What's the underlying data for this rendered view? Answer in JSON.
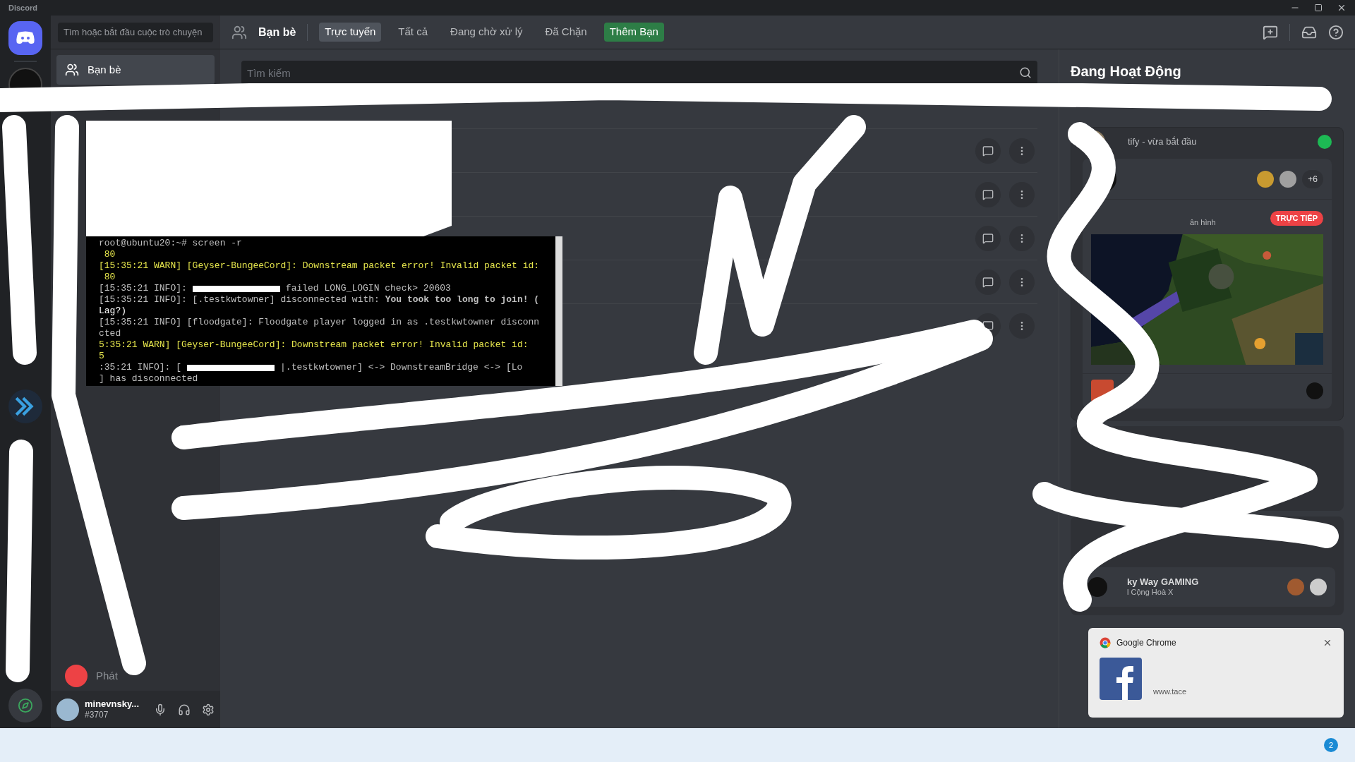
{
  "window": {
    "title": "Discord"
  },
  "sidebar": {
    "search": "Tìm hoặc bắt đầu cuộc trò chuyện",
    "items": [
      {
        "label": "Bạn bè",
        "selected": true
      },
      {
        "label": "Phát",
        "selected": false
      }
    ]
  },
  "user": {
    "name": "minevnsky...",
    "tag": "#3707"
  },
  "header": {
    "title": "Bạn bè",
    "tabs": [
      {
        "label": "Trực tuyến",
        "selected": true,
        "kind": "tab"
      },
      {
        "label": "Tất cả",
        "selected": false,
        "kind": "tab"
      },
      {
        "label": "Đang chờ xử lý",
        "selected": false,
        "kind": "tab"
      },
      {
        "label": "Đã Chặn",
        "selected": false,
        "kind": "tab"
      },
      {
        "label": "Thêm Bạn",
        "selected": false,
        "kind": "add"
      }
    ]
  },
  "search": {
    "placeholder": "Tìm kiếm"
  },
  "terminal": {
    "lines": [
      {
        "parts": [
          {
            "kind": "text",
            "color": "#c0c0c0",
            "text": "root@ubuntu20:~# screen -r"
          }
        ]
      },
      {
        "parts": [
          {
            "kind": "text",
            "color": "#e5e54c",
            "text": " 80"
          }
        ]
      },
      {
        "parts": [
          {
            "kind": "text",
            "color": "#e5e54c",
            "text": "[15:35:21 WARN] [Geyser-BungeeCord]: Downstream packet error! Invalid packet id:"
          }
        ]
      },
      {
        "parts": [
          {
            "kind": "text",
            "color": "#e5e54c",
            "text": " 80"
          }
        ]
      },
      {
        "parts": [
          {
            "kind": "text",
            "color": "#c0c0c0",
            "text": "[15:35:21 INFO]:"
          },
          {
            "kind": "redaction"
          },
          {
            "kind": "text",
            "color": "#c0c0c0",
            "text": "failed LONG_LOGIN check> 20603"
          }
        ]
      },
      {
        "parts": [
          {
            "kind": "text",
            "color": "#c0c0c0",
            "text": "[15:35:21 INFO]: [.testkwtowner] disconnected with: **You took too long to join! (**"
          }
        ]
      },
      {
        "parts": [
          {
            "kind": "text",
            "color": "#ffffff",
            "text": "Lag?)"
          }
        ]
      },
      {
        "parts": [
          {
            "kind": "text",
            "color": "#c0c0c0",
            "text": "[15:35:21 INFO] [floodgate]: Floodgate player logged in as .testkwtowner disconn"
          }
        ]
      },
      {
        "parts": [
          {
            "kind": "text",
            "color": "#c0c0c0",
            "text": "cted"
          }
        ]
      },
      {
        "parts": [
          {
            "kind": "text",
            "color": "#e5e54c",
            "text": "5:35:21 WARN] [Geyser-BungeeCord]: Downstream packet error! Invalid packet id:"
          }
        ]
      },
      {
        "parts": [
          {
            "kind": "text",
            "color": "#e5e54c",
            "text": "5"
          }
        ]
      },
      {
        "parts": [
          {
            "kind": "text",
            "color": "#c0c0c0",
            "text": ":35:21 INFO]: ["
          },
          {
            "kind": "redaction"
          },
          {
            "kind": "text",
            "color": "#c0c0c0",
            "text": "|.testkwtowner] <-> DownstreamBridge <-> [Lo"
          }
        ]
      },
      {
        "parts": [
          {
            "kind": "text",
            "color": "#c0c0c0",
            "text": "] has disconnected"
          }
        ]
      }
    ]
  },
  "activity": {
    "title": "Đang Hoạt Động",
    "now_playing": {
      "text": "tify - vừa bắt đầu"
    },
    "stream": {
      "extra_count": "+6",
      "subtitle": "ân hình",
      "badge": "TRỰC TIẾP"
    },
    "group": {
      "name": "ky Way GAMING",
      "subtitle": "l Cộng Hoà X"
    }
  },
  "notification": {
    "app": "Google Chrome",
    "url": "www.tace"
  },
  "taskbar": {
    "badge": "2"
  }
}
